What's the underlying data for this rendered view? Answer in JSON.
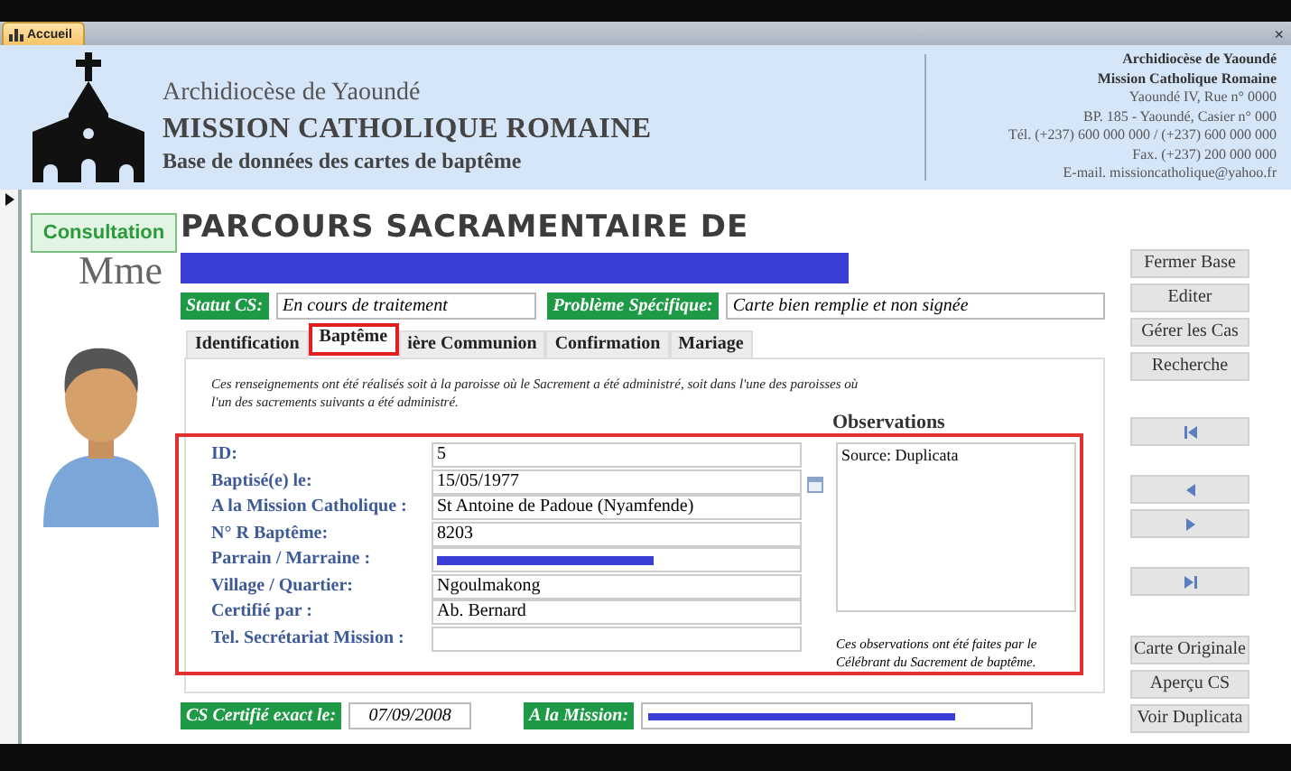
{
  "app_tab": {
    "label": "Accueil",
    "selected": true
  },
  "close_glyph": "×",
  "header": {
    "archdiocese": "Archidiocèse de Yaoundé",
    "mission": "MISSION CATHOLIQUE ROMAINE",
    "subtitle": "Base de données des cartes de baptême",
    "contact": [
      {
        "text": "Archidiocèse de Yaoundé",
        "kind": "bold"
      },
      {
        "text": "Mission Catholique Romaine",
        "kind": "bold"
      },
      {
        "text": "Yaoundé IV, Rue n° 0000",
        "kind": "plain"
      },
      {
        "text": "BP. 185 - Yaoundé, Casier n° 000",
        "kind": "plain"
      },
      {
        "text": "Tél. (+237) 600 000 000 / (+237) 600 000 000",
        "kind": "plain"
      },
      {
        "text": "Fax. (+237) 200 000 000",
        "kind": "plain"
      },
      {
        "text": "E-mail. missioncatholique@yahoo.fr",
        "kind": "plain"
      }
    ]
  },
  "mode": "Consultation",
  "title": "PARCOURS SACRAMENTAIRE DE",
  "name_redacted": true,
  "salutation": "Mme",
  "status": {
    "label": "Statut CS:",
    "value": "En cours de traitement"
  },
  "problem": {
    "label": "Problème Spécifique:",
    "value": "Carte bien remplie et non signée"
  },
  "tabs": [
    {
      "label": "Identification",
      "selected": false
    },
    {
      "label": "Baptême",
      "selected": true
    },
    {
      "label": "ière Communion",
      "selected": false
    },
    {
      "label": "Confirmation",
      "selected": false
    },
    {
      "label": "Mariage",
      "selected": false
    }
  ],
  "note": "Ces renseignements ont été réalisés soit à la paroisse où le Sacrement a été administré, soit dans l'une des paroisses où l'un des sacrements suivants a été administré.",
  "fields": [
    {
      "label": "ID:",
      "value": "5",
      "kind": "text"
    },
    {
      "label": "Baptisé(e) le:",
      "value": "15/05/1977",
      "kind": "date"
    },
    {
      "label": "A la Mission Catholique :",
      "value": "St Antoine de Padoue (Nyamfende)",
      "kind": "text"
    },
    {
      "label": "N° R Baptême:",
      "value": "8203",
      "kind": "text"
    },
    {
      "label": "Parrain / Marraine :",
      "redacted": true,
      "kind": "text"
    },
    {
      "label": "Village / Quartier:",
      "value": "Ngoulmakong",
      "kind": "text"
    },
    {
      "label": "Certifié par :",
      "value": "Ab. Bernard",
      "kind": "text"
    },
    {
      "label": "Tel. Secrétariat Mission :",
      "kind": "text"
    }
  ],
  "observations": {
    "title": "Observations",
    "value": "Source: Duplicata",
    "note": "Ces observations ont été faites par le Célébrant du Sacrement de baptême."
  },
  "certified": {
    "label": "CS Certifié exact le:",
    "value": "07/09/2008"
  },
  "mission_field": {
    "label": "A la Mission:",
    "redacted": true
  },
  "button_groups": [
    [
      {
        "kind": "text",
        "label": "Fermer Base"
      },
      {
        "kind": "text",
        "label": "Editer"
      },
      {
        "kind": "text",
        "label": "Gérer les Cas"
      },
      {
        "kind": "text",
        "label": "Recherche"
      }
    ],
    [
      {
        "kind": "first"
      }
    ],
    [
      {
        "kind": "previous"
      },
      {
        "kind": "next"
      }
    ],
    [
      {
        "kind": "last"
      }
    ],
    [
      {
        "kind": "text",
        "label": "Carte Originale"
      },
      {
        "kind": "text",
        "label": "Aperçu CS"
      },
      {
        "kind": "text",
        "label": "Voir Duplicata"
      }
    ]
  ]
}
